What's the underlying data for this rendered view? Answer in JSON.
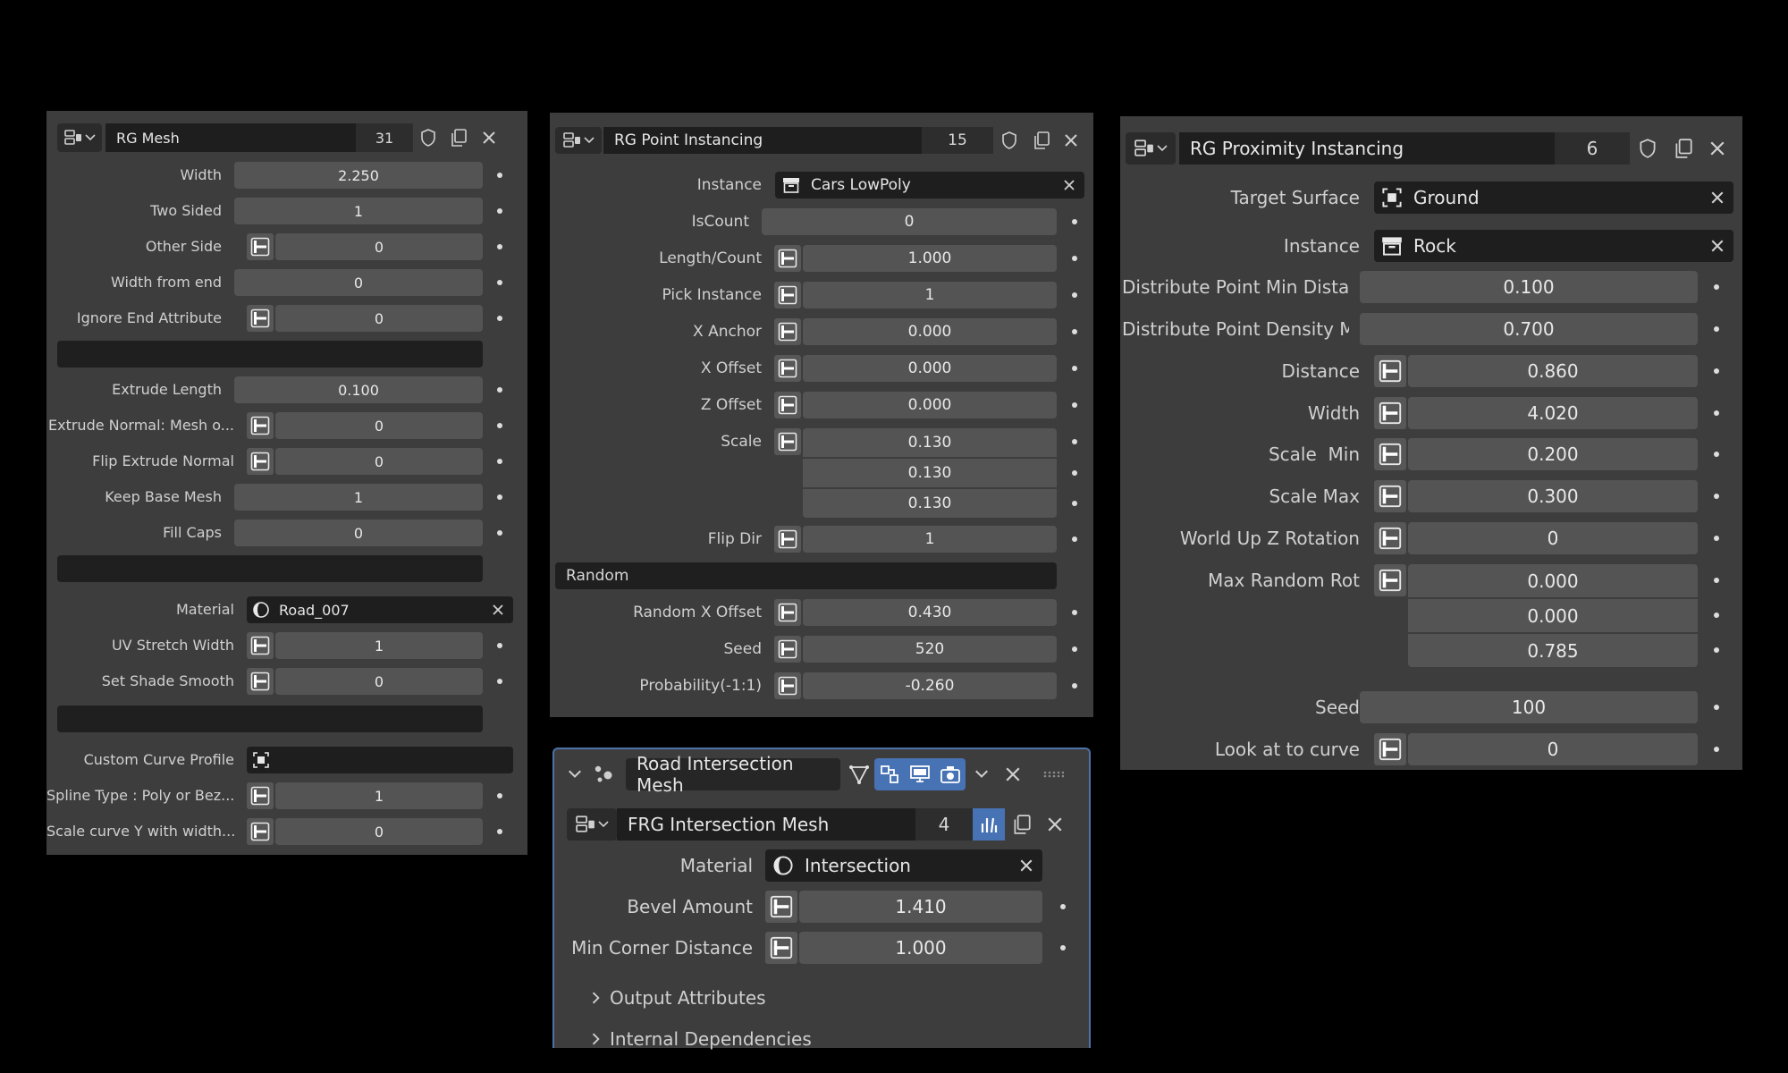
{
  "panel1": {
    "header": {
      "title": "RG Mesh",
      "count": "31"
    },
    "rows": {
      "width": {
        "label": "Width",
        "value": "2.250"
      },
      "two_sided": {
        "label": "Two Sided",
        "value": "1"
      },
      "other_side": {
        "label": "Other Side",
        "value": "0"
      },
      "width_from_end": {
        "label": "Width from end",
        "value": "0"
      },
      "ignore_end_attribute": {
        "label": "Ignore End Attribute",
        "value": "0"
      },
      "extrude_length": {
        "label": "Extrude Length",
        "value": "0.100"
      },
      "extrude_normal": {
        "label": "Extrude Normal: Mesh o...",
        "value": "0"
      },
      "flip_extrude_normal": {
        "label": "Flip Extrude Normal",
        "value": "0"
      },
      "keep_base_mesh": {
        "label": "Keep Base Mesh",
        "value": "1"
      },
      "fill_caps": {
        "label": "Fill Caps",
        "value": "0"
      },
      "material": {
        "label": "Material",
        "value": "Road_007"
      },
      "uv_stretch_width": {
        "label": "UV Stretch Width",
        "value": "1"
      },
      "set_shade_smooth": {
        "label": "Set Shade Smooth",
        "value": "0"
      },
      "custom_curve_profile": {
        "label": "Custom Curve Profile",
        "value": ""
      },
      "spline_type": {
        "label": "Spline Type : Poly or Bez...",
        "value": "1"
      },
      "scale_curve_y": {
        "label": "Scale curve Y with width...",
        "value": "0"
      }
    }
  },
  "panel2": {
    "header": {
      "title": "RG Point Instancing",
      "count": "15"
    },
    "rows": {
      "instance": {
        "label": "Instance",
        "value": "Cars LowPoly"
      },
      "iscount": {
        "label": "IsCount",
        "value": "0"
      },
      "length_count": {
        "label": "Length/Count",
        "value": "1.000"
      },
      "pick_instance": {
        "label": "Pick Instance",
        "value": "1"
      },
      "x_anchor": {
        "label": "X Anchor",
        "value": "0.000"
      },
      "x_offset": {
        "label": "X Offset",
        "value": "0.000"
      },
      "z_offset": {
        "label": "Z Offset",
        "value": "0.000"
      },
      "scale": {
        "label": "Scale",
        "x": "0.130",
        "y": "0.130",
        "z": "0.130"
      },
      "flip_dir": {
        "label": "Flip Dir",
        "value": "1"
      },
      "random_section": {
        "label": "Random"
      },
      "random_x_offset": {
        "label": "Random X Offset",
        "value": "0.430"
      },
      "seed": {
        "label": "Seed",
        "value": "520"
      },
      "probability": {
        "label": "Probability(-1:1)",
        "value": "-0.260"
      }
    }
  },
  "panel3": {
    "header": {
      "title": "RG Proximity Instancing",
      "count": "6"
    },
    "rows": {
      "target_surface": {
        "label": "Target Surface",
        "value": "Ground"
      },
      "instance": {
        "label": "Instance",
        "value": "Rock"
      },
      "dist_point_min": {
        "label": "Distribute Point Min Distan...",
        "value": "0.100"
      },
      "dist_point_density": {
        "label": "Distribute Point Density M...",
        "value": "0.700"
      },
      "distance": {
        "label": "Distance",
        "value": "0.860"
      },
      "width": {
        "label": "Width",
        "value": "4.020"
      },
      "scale_min": {
        "label": "Scale  Min",
        "value": "0.200"
      },
      "scale_max": {
        "label": "Scale Max",
        "value": "0.300"
      },
      "world_up_z": {
        "label": "World Up Z Rotation",
        "value": "0"
      },
      "max_random_rot": {
        "label": "Max Random Rot",
        "x": "0.000",
        "y": "0.000",
        "z": "0.785"
      },
      "seed": {
        "label": "Seed",
        "value": "100"
      },
      "look_at_curve": {
        "label": "Look at to curve",
        "value": "0"
      }
    }
  },
  "panel4": {
    "modifier": {
      "name": "Road Intersection Mesh"
    },
    "header": {
      "title": "FRG Intersection Mesh",
      "count": "4"
    },
    "rows": {
      "material": {
        "label": "Material",
        "value": "Intersection"
      },
      "bevel_amount": {
        "label": "Bevel Amount",
        "value": "1.410"
      },
      "min_corner_distance": {
        "label": "Min Corner Distance",
        "value": "1.000"
      }
    },
    "subpanels": {
      "output_attributes": "Output Attributes",
      "internal_dependencies": "Internal Dependencies"
    }
  },
  "colors": {
    "panel_bg": "#3d3d3d",
    "field_bg": "#545454",
    "dark_field": "#1e1e1e",
    "accent_blue": "#4772b3",
    "modifier_border": "#4d72a8"
  }
}
